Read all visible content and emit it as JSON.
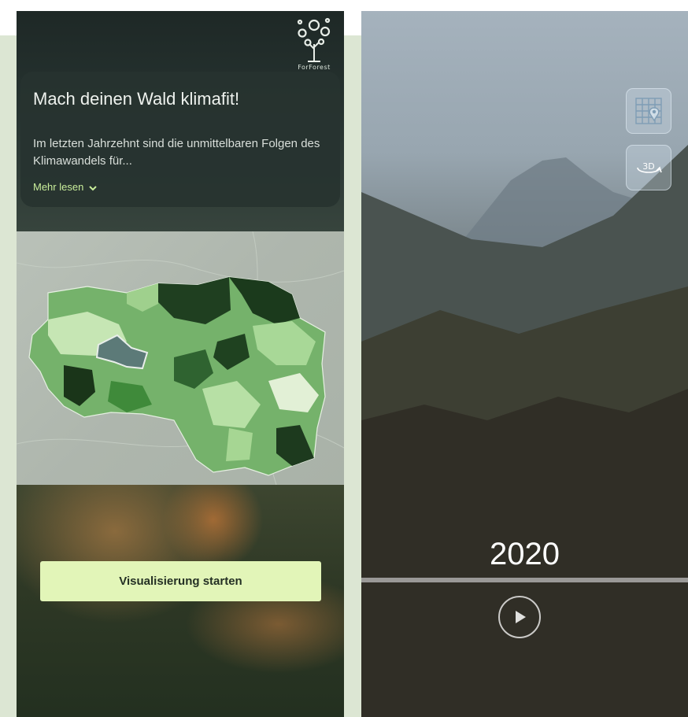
{
  "sidebar": {
    "logo_text": "ForForest",
    "card": {
      "title": "Mach deinen Wald klimafit!",
      "text": "Im letzten Jahrzehnt sind die unmittelbaren Folgen des Klimawandels für...",
      "more_label": "Mehr lesen"
    },
    "start_button": "Visualisierung starten"
  },
  "viewer": {
    "year": "2020",
    "map_button_icon": "map-pin-icon",
    "view3d_label": "3D",
    "play_icon": "play-icon"
  },
  "colors": {
    "accent": "#e2f5b8",
    "link": "#c9ee9b",
    "selected_region": "#5c7a78"
  }
}
